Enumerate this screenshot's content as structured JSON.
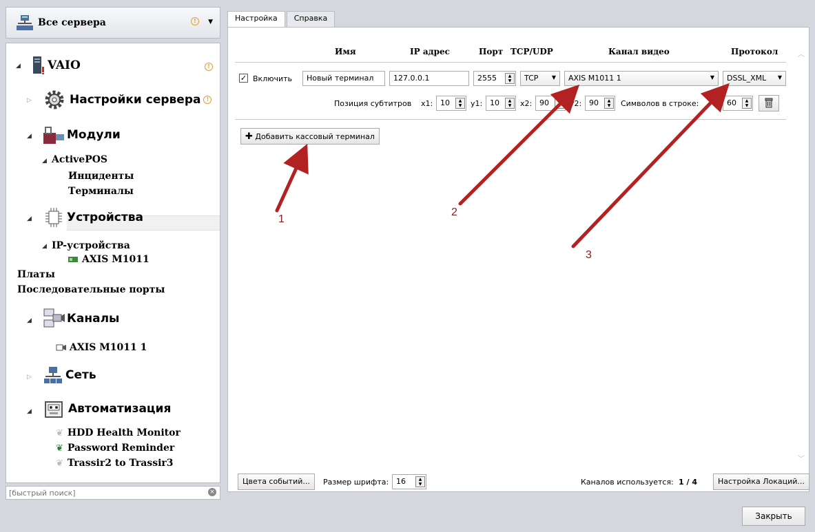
{
  "sidebar": {
    "server_selector": "Все сервера",
    "tree": {
      "server": "VAIO",
      "server_settings": "Настройки сервера",
      "modules": "Модули",
      "activepos": "ActivePOS",
      "incidents": "Инциденты",
      "terminals": "Терминалы",
      "devices": "Устройства",
      "ip_devices": "IP-устройства",
      "axis_device": "AXIS M1011",
      "boards": "Платы",
      "serial_ports": "Последовательные порты",
      "channels": "Каналы",
      "axis_channel": "AXIS M1011 1",
      "network": "Сеть",
      "automation": "Автоматизация",
      "scripts": [
        "HDD Health Monitor",
        "Password Reminder",
        "Trassir2 to Trassir3"
      ]
    },
    "search_placeholder": "[быстрый поиск]"
  },
  "tabs": [
    "Настройка",
    "Справка"
  ],
  "table": {
    "headers": {
      "name": "Имя",
      "ip": "IP адрес",
      "port": "Порт",
      "tcpudp": "TCP/UDP",
      "channel": "Канал видео",
      "protocol": "Протокол"
    },
    "row": {
      "enable_label": "Включить",
      "name": "Новый терминал",
      "ip": "127.0.0.1",
      "port": "2555",
      "transport": "TCP",
      "channel": "AXIS M1011 1",
      "protocol": "DSSL_XML"
    },
    "subtitles": {
      "label": "Позиция субтитров",
      "x1_label": "x1:",
      "x1": "10",
      "y1_label": "y1:",
      "y1": "10",
      "x2_label": "x2:",
      "x2": "90",
      "y2_label": "y2:",
      "y2": "90",
      "chars_label": "Символов в строке:",
      "chars": "60"
    }
  },
  "add_terminal_button": "Добавить кассовый терминал",
  "annotations": [
    "1",
    "2",
    "3"
  ],
  "footer": {
    "event_colors_button": "Цвета событий...",
    "font_size_label": "Размер шрифта:",
    "font_size": "16",
    "channels_used_label": "Каналов используется:",
    "channels_used": "1 / 4",
    "locations_button": "Настройка Локаций..."
  },
  "close_button": "Закрыть",
  "colors": {
    "annotation_arrow": "#b22222",
    "warning": "#e0a030"
  }
}
